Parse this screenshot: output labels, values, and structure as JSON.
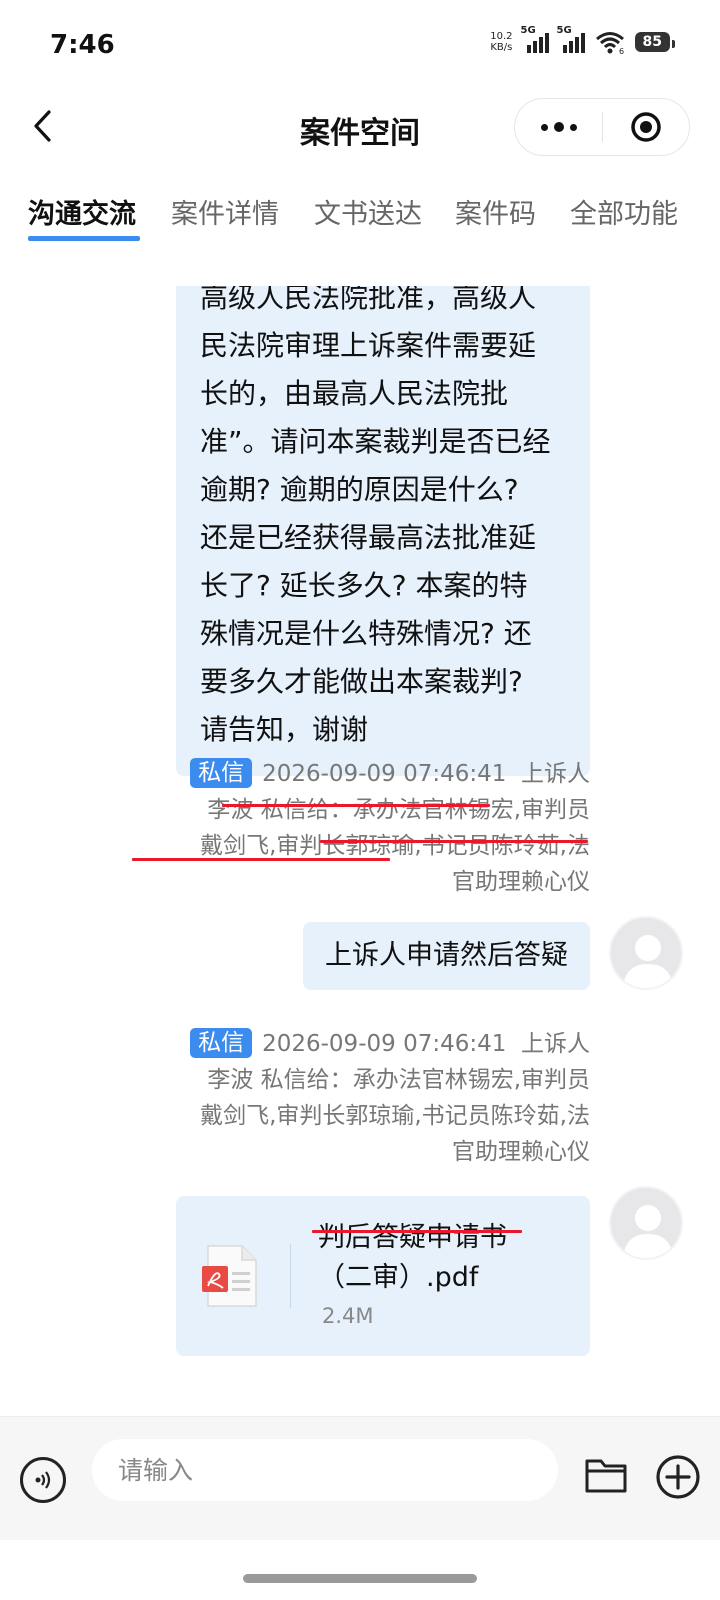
{
  "status_bar": {
    "time": "7:46",
    "net_speed_value": "10.2",
    "net_speed_unit": "KB/s",
    "signal1_label": "5G",
    "signal2_label": "5G",
    "wifi_label": "6",
    "battery": "85"
  },
  "header": {
    "title": "案件空间"
  },
  "tabs": [
    {
      "label": "沟通交流",
      "active": true
    },
    {
      "label": "案件详情",
      "active": false
    },
    {
      "label": "文书送达",
      "active": false
    },
    {
      "label": "案件码",
      "active": false
    },
    {
      "label": "全部功能",
      "active": false
    }
  ],
  "messages": {
    "first_bubble_lines": [
      "高级人民法院批准，高级人",
      "民法院审理上诉案件需要延",
      "长的，由最高人民法院批",
      "准”。请问本案裁判是否已经",
      "逾期? 逾期的原因是什么?",
      "还是已经获得最高法批准延",
      "长了? 延长多久? 本案的特",
      "殊情况是什么特殊情况? 还",
      "要多久才能做出本案裁判?",
      "请告知，谢谢"
    ],
    "msg2": {
      "badge": "私信",
      "timestamp": "2026-09-09 07:46:41",
      "sender_role": "上诉人",
      "line2_prefix": "李波  私信给：",
      "line2_recipients": "承办法官林锡宏,审判员",
      "line3": "戴剑飞,审判长郭琼瑜,书记员陈玲茹,法",
      "line4": "官助理赖心仪",
      "text": "上诉人申请然后答疑"
    },
    "msg3": {
      "badge": "私信",
      "timestamp": "2026-09-09 07:46:41",
      "sender_role": "上诉人",
      "line2_prefix": "李波  私信给：",
      "line2_recipients": "承办法官林锡宏,审判员",
      "line3": "戴剑飞,审判长郭琼瑜,书记员陈玲茹,法",
      "line4": "官助理赖心仪",
      "file_name_line1": "判后答疑申请书",
      "file_name_line2": "（二审）.pdf",
      "file_size": "2.4M"
    }
  },
  "input": {
    "placeholder": "请输入"
  },
  "colors": {
    "accent": "#3c8cf0",
    "bubble": "#e6f1fc",
    "annotation_red": "#e8192c"
  }
}
